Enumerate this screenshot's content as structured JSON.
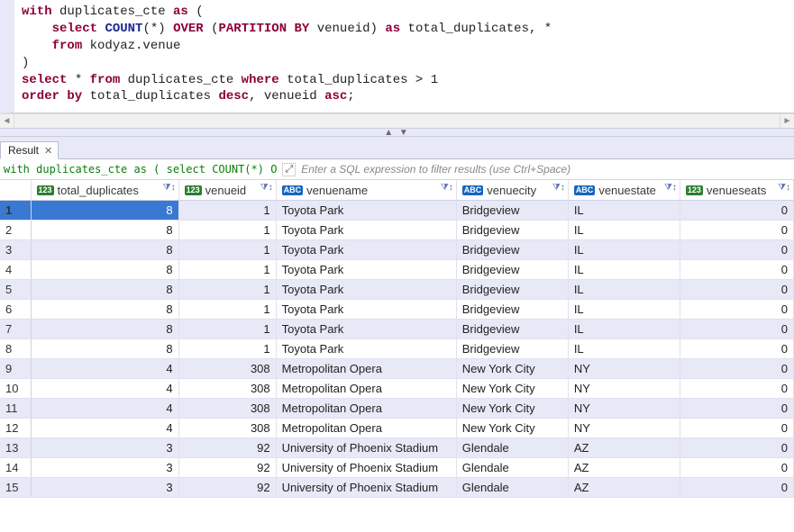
{
  "editor": {
    "sql_tokens": [
      [
        {
          "t": "kw",
          "v": "with"
        },
        {
          "t": "id",
          "v": " duplicates_cte "
        },
        {
          "t": "kw",
          "v": "as"
        },
        {
          "t": "id",
          "v": " ("
        }
      ],
      [
        {
          "t": "id",
          "v": "    "
        },
        {
          "t": "kw",
          "v": "select"
        },
        {
          "t": "id",
          "v": " "
        },
        {
          "t": "func",
          "v": "COUNT"
        },
        {
          "t": "id",
          "v": "(*) "
        },
        {
          "t": "kw",
          "v": "OVER"
        },
        {
          "t": "id",
          "v": " ("
        },
        {
          "t": "kw",
          "v": "PARTITION BY"
        },
        {
          "t": "id",
          "v": " venueid) "
        },
        {
          "t": "kw",
          "v": "as"
        },
        {
          "t": "id",
          "v": " total_duplicates, *"
        }
      ],
      [
        {
          "t": "id",
          "v": "    "
        },
        {
          "t": "kw",
          "v": "from"
        },
        {
          "t": "id",
          "v": " kodyaz.venue"
        }
      ],
      [
        {
          "t": "id",
          "v": ")"
        }
      ],
      [
        {
          "t": "kw",
          "v": "select"
        },
        {
          "t": "id",
          "v": " * "
        },
        {
          "t": "kw",
          "v": "from"
        },
        {
          "t": "id",
          "v": " duplicates_cte "
        },
        {
          "t": "kw",
          "v": "where"
        },
        {
          "t": "id",
          "v": " total_duplicates > "
        },
        {
          "t": "num",
          "v": "1"
        }
      ],
      [
        {
          "t": "kw",
          "v": "order by"
        },
        {
          "t": "id",
          "v": " total_duplicates "
        },
        {
          "t": "kw",
          "v": "desc"
        },
        {
          "t": "id",
          "v": ", venueid "
        },
        {
          "t": "kw",
          "v": "asc"
        },
        {
          "t": "id",
          "v": ";"
        }
      ]
    ]
  },
  "tabs": {
    "result_label": "Result"
  },
  "filter": {
    "preview": "with duplicates_cte as ( select COUNT(*) O",
    "placeholder": "Enter a SQL expression to filter results (use Ctrl+Space)"
  },
  "columns": [
    {
      "name": "total_duplicates",
      "type": "num"
    },
    {
      "name": "venueid",
      "type": "num"
    },
    {
      "name": "venuename",
      "type": "txt"
    },
    {
      "name": "venuecity",
      "type": "txt"
    },
    {
      "name": "venuestate",
      "type": "txt"
    },
    {
      "name": "venueseats",
      "type": "num"
    }
  ],
  "rows": [
    {
      "n": 1,
      "total_duplicates": 8,
      "venueid": 1,
      "venuename": "Toyota Park",
      "venuecity": "Bridgeview",
      "venuestate": "IL",
      "venueseats": 0
    },
    {
      "n": 2,
      "total_duplicates": 8,
      "venueid": 1,
      "venuename": "Toyota Park",
      "venuecity": "Bridgeview",
      "venuestate": "IL",
      "venueseats": 0
    },
    {
      "n": 3,
      "total_duplicates": 8,
      "venueid": 1,
      "venuename": "Toyota Park",
      "venuecity": "Bridgeview",
      "venuestate": "IL",
      "venueseats": 0
    },
    {
      "n": 4,
      "total_duplicates": 8,
      "venueid": 1,
      "venuename": "Toyota Park",
      "venuecity": "Bridgeview",
      "venuestate": "IL",
      "venueseats": 0
    },
    {
      "n": 5,
      "total_duplicates": 8,
      "venueid": 1,
      "venuename": "Toyota Park",
      "venuecity": "Bridgeview",
      "venuestate": "IL",
      "venueseats": 0
    },
    {
      "n": 6,
      "total_duplicates": 8,
      "venueid": 1,
      "venuename": "Toyota Park",
      "venuecity": "Bridgeview",
      "venuestate": "IL",
      "venueseats": 0
    },
    {
      "n": 7,
      "total_duplicates": 8,
      "venueid": 1,
      "venuename": "Toyota Park",
      "venuecity": "Bridgeview",
      "venuestate": "IL",
      "venueseats": 0
    },
    {
      "n": 8,
      "total_duplicates": 8,
      "venueid": 1,
      "venuename": "Toyota Park",
      "venuecity": "Bridgeview",
      "venuestate": "IL",
      "venueseats": 0
    },
    {
      "n": 9,
      "total_duplicates": 4,
      "venueid": 308,
      "venuename": "Metropolitan Opera",
      "venuecity": "New York City",
      "venuestate": "NY",
      "venueseats": 0
    },
    {
      "n": 10,
      "total_duplicates": 4,
      "venueid": 308,
      "venuename": "Metropolitan Opera",
      "venuecity": "New York City",
      "venuestate": "NY",
      "venueseats": 0
    },
    {
      "n": 11,
      "total_duplicates": 4,
      "venueid": 308,
      "venuename": "Metropolitan Opera",
      "venuecity": "New York City",
      "venuestate": "NY",
      "venueseats": 0
    },
    {
      "n": 12,
      "total_duplicates": 4,
      "venueid": 308,
      "venuename": "Metropolitan Opera",
      "venuecity": "New York City",
      "venuestate": "NY",
      "venueseats": 0
    },
    {
      "n": 13,
      "total_duplicates": 3,
      "venueid": 92,
      "venuename": "University of Phoenix Stadium",
      "venuecity": "Glendale",
      "venuestate": "AZ",
      "venueseats": 0
    },
    {
      "n": 14,
      "total_duplicates": 3,
      "venueid": 92,
      "venuename": "University of Phoenix Stadium",
      "venuecity": "Glendale",
      "venuestate": "AZ",
      "venueseats": 0
    },
    {
      "n": 15,
      "total_duplicates": 3,
      "venueid": 92,
      "venuename": "University of Phoenix Stadium",
      "venuecity": "Glendale",
      "venuestate": "AZ",
      "venueseats": 0
    }
  ],
  "selection": {
    "row": 1,
    "col": 0
  },
  "icons": {
    "filter_glyph": "⧩↕",
    "type_num": "123",
    "type_txt": "ABC"
  }
}
